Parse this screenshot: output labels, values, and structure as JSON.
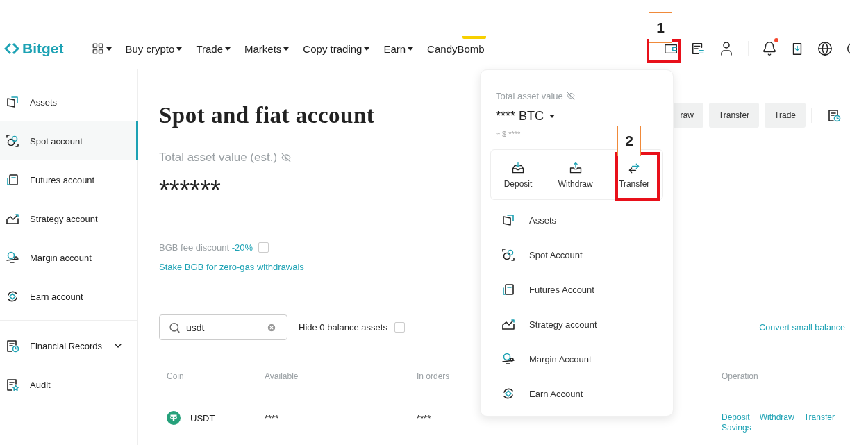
{
  "header": {
    "logo": "Bitget",
    "nav": [
      {
        "label": "Buy crypto"
      },
      {
        "label": "Trade"
      },
      {
        "label": "Markets"
      },
      {
        "label": "Copy trading"
      },
      {
        "label": "Earn"
      },
      {
        "label": "CandyBomb"
      }
    ],
    "notification_dot": true
  },
  "sidebar": {
    "items": [
      {
        "label": "Assets",
        "selected": false
      },
      {
        "label": "Spot account",
        "selected": true
      },
      {
        "label": "Futures account",
        "selected": false
      },
      {
        "label": "Strategy account",
        "selected": false
      },
      {
        "label": "Margin account",
        "selected": false
      },
      {
        "label": "Earn account",
        "selected": false
      }
    ],
    "footer_items": [
      {
        "label": "Financial Records",
        "expanded": false
      },
      {
        "label": "Audit"
      }
    ]
  },
  "main": {
    "title": "Spot and fiat account",
    "actions": [
      "raw",
      "Transfer",
      "Trade"
    ],
    "total_label": "Total asset value (est.)",
    "total_value": "******",
    "fee_label": "BGB fee discount ",
    "fee_value": "-20%",
    "fee_checked": false,
    "stake_link": "Stake BGB for zero-gas withdrawals",
    "search": {
      "value": "usdt"
    },
    "hide_zero": {
      "label": "Hide 0 balance assets",
      "checked": false
    },
    "convert_link": "Convert small balance",
    "table": {
      "columns": [
        "Coin",
        "Available",
        "In orders",
        "",
        "Operation"
      ],
      "rows": [
        {
          "coin": "USDT",
          "available": "****",
          "in_orders": "****",
          "operations": [
            "Deposit",
            "Withdraw",
            "Transfer",
            "Savings"
          ]
        }
      ]
    }
  },
  "popup": {
    "total_label": "Total asset value",
    "value": "**** BTC",
    "usd": "≈ $ ****",
    "actions": [
      "Deposit",
      "Withdraw",
      "Transfer"
    ],
    "items": [
      "Assets",
      "Spot Account",
      "Futures Account",
      "Strategy account",
      "Margin Account",
      "Earn Account"
    ]
  },
  "annotations": [
    {
      "label": "1"
    },
    {
      "label": "2"
    }
  ]
}
